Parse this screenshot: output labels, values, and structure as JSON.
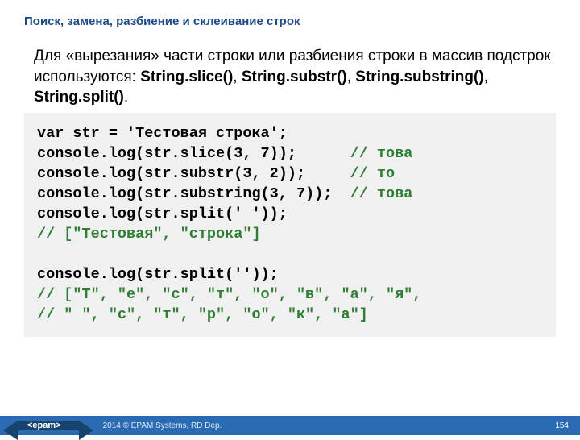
{
  "title": "Поиск, замена, разбиение и склеивание строк",
  "body": {
    "line1": "Для «вырезания» части строки или разбиения строки в массив подстрок используются: ",
    "func1": "String.slice()",
    "sep1": ", ",
    "func2": "String.substr()",
    "sep2": ", ",
    "func3": "String.substring()",
    "sep3": ", ",
    "func4": "String.split()",
    "endpunct": "."
  },
  "code": {
    "l1": "var str = 'Тестовая строка';",
    "l2a": "console.log(str.slice(3, 7));      ",
    "l2c": "// това",
    "l3a": "console.log(str.substr(3, 2));     ",
    "l3c": "// то",
    "l4a": "console.log(str.substring(3, 7));  ",
    "l4c": "// това",
    "l5": "console.log(str.split(' '));",
    "l6c": "// [\"Тестовая\", \"строка\"]",
    "l7": "",
    "l8": "console.log(str.split(''));",
    "l9c": "// [\"Т\", \"е\", \"с\", \"т\", \"о\", \"в\", \"а\", \"я\",",
    "l10c": "// \" \", \"с\", \"т\", \"р\", \"о\", \"к\", \"а\"]"
  },
  "footer": {
    "logo": "<epam>",
    "copyright": "2014 © EPAM Systems, RD Dep.",
    "page": "154"
  }
}
